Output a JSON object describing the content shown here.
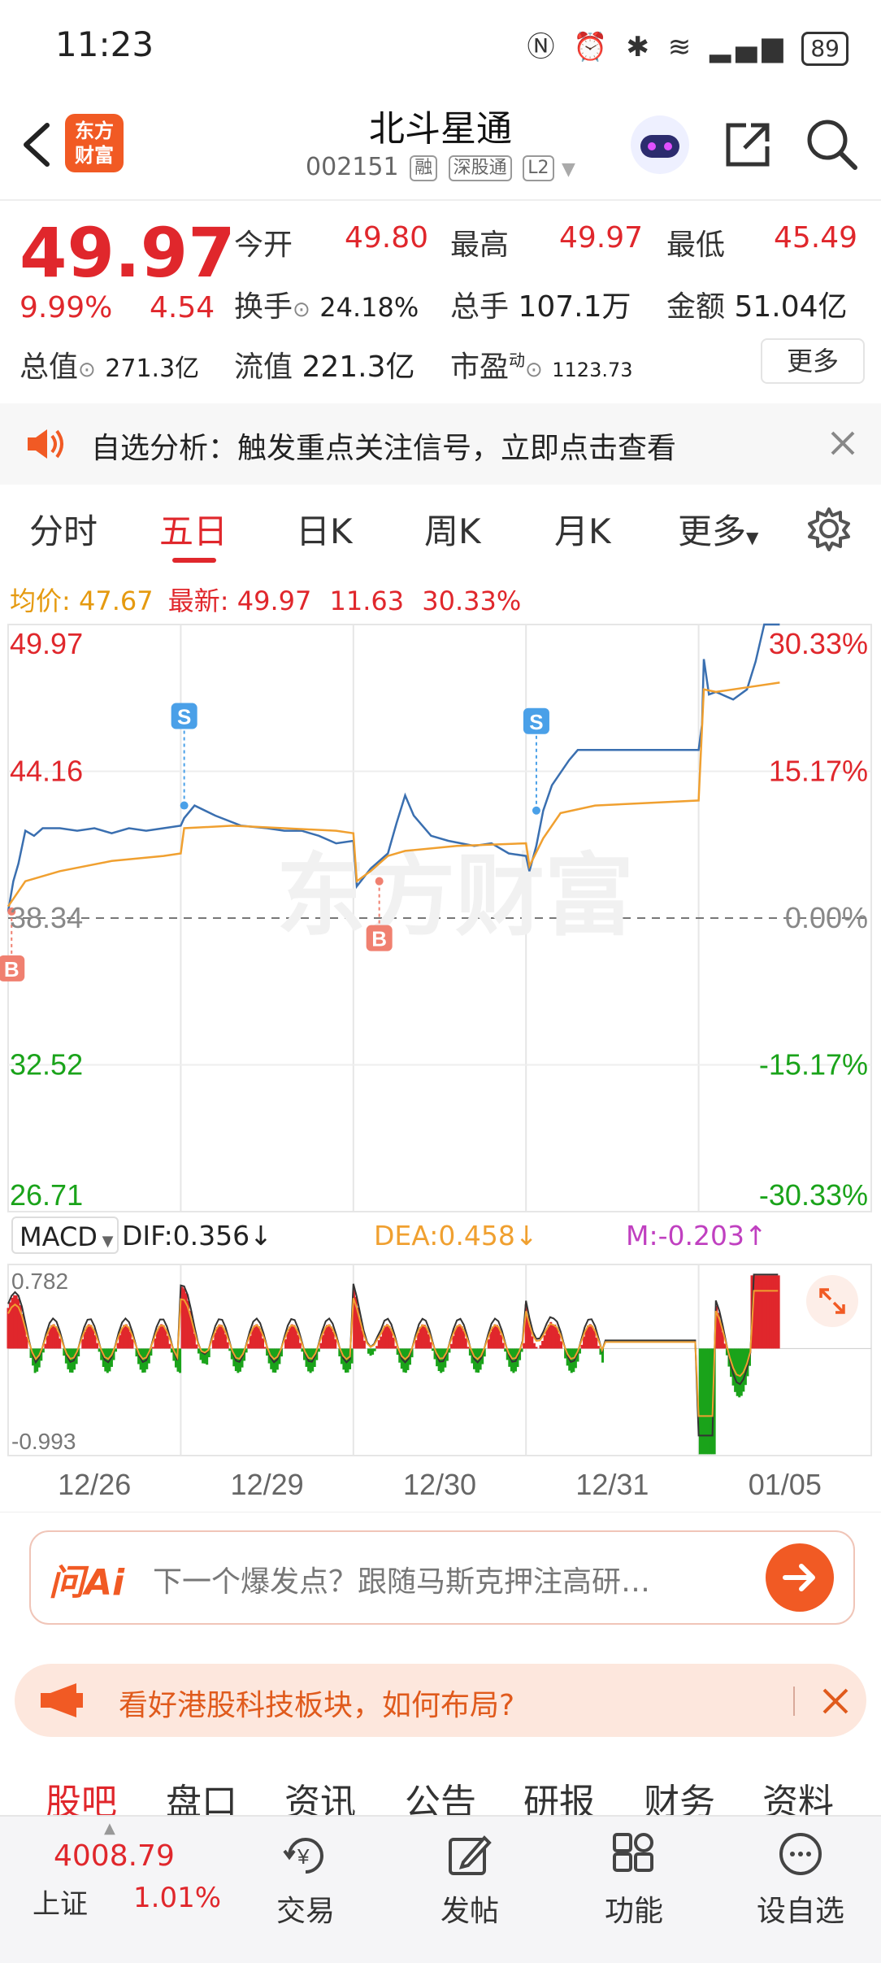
{
  "status": {
    "time": "11:23",
    "battery": "89"
  },
  "header": {
    "logo_line1": "东方",
    "logo_line2": "财富",
    "name": "北斗星通",
    "code": "002151",
    "tags": [
      "融",
      "深股通",
      "L2"
    ]
  },
  "quote": {
    "price": "49.97",
    "change_pct": "9.99%",
    "change_amt": "4.54",
    "open_label": "今开",
    "open": "49.80",
    "high_label": "最高",
    "high": "49.97",
    "low_label": "最低",
    "low": "45.49",
    "turnover_label": "换手",
    "turnover": "24.18%",
    "volume_label": "总手",
    "volume": "107.1万",
    "amount_label": "金额",
    "amount": "51.04亿",
    "mktcap_label": "总值",
    "mktcap": "271.3亿",
    "float_label": "流值",
    "float": "221.3亿",
    "pe_label": "市盈",
    "pe_sup": "动",
    "pe": "1123.73",
    "more": "更多"
  },
  "notice": {
    "text": "自选分析：触发重点关注信号，立即点击查看"
  },
  "tabs": [
    "分时",
    "五日",
    "日K",
    "周K",
    "月K",
    "更多"
  ],
  "active_tab": "五日",
  "chart_info": {
    "avg_label": "均价:",
    "avg": "47.67",
    "latest_label": "最新:",
    "latest": "49.97",
    "chg": "11.63",
    "pct": "30.33%"
  },
  "chart_data": {
    "type": "line",
    "y_left_ticks": [
      "49.97",
      "44.16",
      "38.34",
      "32.52",
      "26.71"
    ],
    "y_right_ticks": [
      "30.33%",
      "15.17%",
      "0.00%",
      "-15.17%",
      "-30.33%"
    ],
    "x_ticks": [
      "12/26",
      "12/29",
      "12/30",
      "12/31",
      "01/05"
    ],
    "ylim": [
      26.71,
      49.97
    ],
    "baseline": 38.34,
    "markers": [
      {
        "label": "B",
        "day": "12/26"
      },
      {
        "label": "S",
        "day": "12/29"
      },
      {
        "label": "B",
        "day": "12/30"
      },
      {
        "label": "S",
        "day": "12/31"
      }
    ],
    "series": [
      {
        "name": "price",
        "color": "#3a6fb0",
        "values": [
          [
            0,
            38.6
          ],
          [
            0.03,
            39.8
          ],
          [
            0.06,
            40.5
          ],
          [
            0.1,
            41.8
          ],
          [
            0.15,
            41.6
          ],
          [
            0.2,
            41.9
          ],
          [
            0.3,
            41.9
          ],
          [
            0.4,
            41.8
          ],
          [
            0.5,
            41.9
          ],
          [
            0.6,
            41.7
          ],
          [
            0.7,
            41.9
          ],
          [
            0.8,
            41.8
          ],
          [
            0.9,
            41.9
          ],
          [
            1.0,
            42.0
          ],
          [
            1.02,
            42.3
          ],
          [
            1.08,
            42.8
          ],
          [
            1.2,
            42.4
          ],
          [
            1.35,
            42.0
          ],
          [
            1.5,
            41.9
          ],
          [
            1.6,
            41.8
          ],
          [
            1.7,
            41.8
          ],
          [
            1.8,
            41.6
          ],
          [
            1.9,
            41.3
          ],
          [
            2.0,
            41.4
          ],
          [
            2.02,
            39.6
          ],
          [
            2.1,
            40.3
          ],
          [
            2.2,
            40.9
          ],
          [
            2.25,
            42.1
          ],
          [
            2.3,
            43.2
          ],
          [
            2.35,
            42.4
          ],
          [
            2.45,
            41.6
          ],
          [
            2.55,
            41.4
          ],
          [
            2.7,
            41.2
          ],
          [
            2.8,
            41.3
          ],
          [
            2.9,
            40.9
          ],
          [
            3.0,
            40.8
          ],
          [
            3.02,
            40.2
          ],
          [
            3.06,
            41.2
          ],
          [
            3.1,
            42.6
          ],
          [
            3.15,
            43.6
          ],
          [
            3.25,
            44.6
          ],
          [
            3.3,
            45.0
          ],
          [
            3.5,
            45.0
          ],
          [
            3.7,
            45.0
          ],
          [
            3.9,
            45.0
          ],
          [
            4.0,
            45.0
          ],
          [
            4.02,
            46.0
          ],
          [
            4.03,
            48.6
          ],
          [
            4.06,
            47.2
          ],
          [
            4.1,
            47.3
          ],
          [
            4.2,
            47.0
          ],
          [
            4.28,
            47.4
          ],
          [
            4.33,
            48.5
          ],
          [
            4.38,
            49.97
          ],
          [
            4.47,
            49.97
          ]
        ]
      },
      {
        "name": "avg",
        "color": "#f0a030",
        "values": [
          [
            0,
            38.8
          ],
          [
            0.1,
            39.8
          ],
          [
            0.3,
            40.2
          ],
          [
            0.6,
            40.6
          ],
          [
            0.9,
            40.8
          ],
          [
            1.0,
            40.9
          ],
          [
            1.02,
            41.9
          ],
          [
            1.3,
            42.0
          ],
          [
            1.6,
            41.9
          ],
          [
            1.9,
            41.8
          ],
          [
            2.0,
            41.7
          ],
          [
            2.02,
            39.8
          ],
          [
            2.1,
            40.2
          ],
          [
            2.2,
            40.8
          ],
          [
            2.3,
            41.0
          ],
          [
            2.6,
            41.2
          ],
          [
            3.0,
            41.3
          ],
          [
            3.02,
            40.4
          ],
          [
            3.1,
            41.5
          ],
          [
            3.2,
            42.5
          ],
          [
            3.4,
            42.8
          ],
          [
            3.7,
            42.9
          ],
          [
            4.0,
            43.0
          ],
          [
            4.03,
            47.4
          ],
          [
            4.1,
            47.3
          ],
          [
            4.3,
            47.5
          ],
          [
            4.47,
            47.67
          ]
        ]
      }
    ]
  },
  "macd": {
    "selector": "MACD",
    "dif": "DIF:0.356↓",
    "dea": "DEA:0.458↓",
    "m": "M:-0.203↑",
    "top": "0.782",
    "bottom": "-0.993"
  },
  "ai": {
    "logo": "问Ai",
    "placeholder": "下一个爆发点？跟随马斯克押注高研…"
  },
  "promo": {
    "text": "看好港股科技板块，如何布局?"
  },
  "feed_tabs": [
    "股吧",
    "盘口",
    "资讯",
    "公告",
    "研报",
    "财务",
    "资料"
  ],
  "active_feed_tab": "股吧",
  "bottom": {
    "index_value": "4008.79",
    "index_name": "上证",
    "index_pct": "1.01%",
    "items": [
      "交易",
      "发帖",
      "功能",
      "设自选"
    ]
  },
  "colors": {
    "up": "#e0272c",
    "down": "#1aa31a",
    "accent": "#f15a24",
    "price_line": "#3a6fb0",
    "avg_line": "#f0a030",
    "dea": "#f0a030",
    "m": "#c040c0"
  }
}
